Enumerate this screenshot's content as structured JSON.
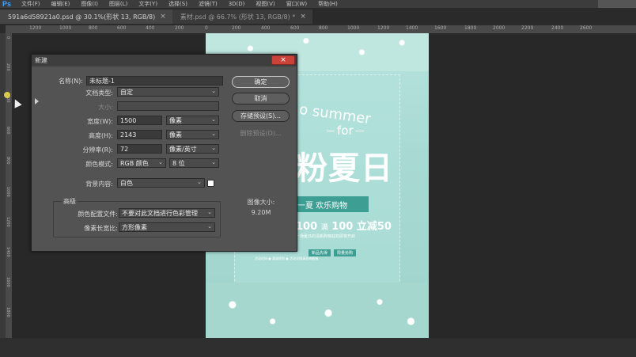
{
  "menubar": {
    "logo": "Ps",
    "items": [
      "文件(F)",
      "编辑(E)",
      "图像(I)",
      "图层(L)",
      "文字(Y)",
      "选择(S)",
      "滤镜(T)",
      "3D(D)",
      "视图(V)",
      "窗口(W)",
      "帮助(H)"
    ]
  },
  "tabs": [
    {
      "label": "591a6d58921a0.psd @ 30.1%(形状 13, RGB/8)",
      "close": "×"
    },
    {
      "label": "素材.psd @ 66.7% (形状 13, RGB/8) *",
      "close": "×"
    }
  ],
  "ruler": {
    "h_labels": [
      "1200",
      "1000",
      "800",
      "600",
      "400",
      "200",
      "0",
      "200",
      "400",
      "600",
      "800",
      "1000",
      "1200",
      "1400",
      "1600",
      "1800",
      "2000",
      "2200",
      "2400",
      "2600"
    ],
    "v_labels": [
      "0",
      "200",
      "400",
      "600",
      "800",
      "1000",
      "1200",
      "1400",
      "1600",
      "1800"
    ]
  },
  "poster": {
    "summer": "o summer",
    "for": "for",
    "title": "粉夏日",
    "ribbon": "一夏 欢乐购物",
    "promo_a": "100",
    "promo_mid": "满",
    "promo_b": "100",
    "promo_c": "立减50",
    "desc": "一场夏日的清新购物狂欢即将开启",
    "btn1": "新品先得",
    "btn2": "限量抢购",
    "fine": "活动时间 ● 满减规则 ● 活动详情请咨询客服"
  },
  "dialog": {
    "title": "新建",
    "close": "×",
    "name_label": "名称(N):",
    "name_value": "未标题-1",
    "doctype_label": "文档类型:",
    "doctype_value": "自定",
    "size_label": "大小:",
    "width_label": "宽度(W):",
    "width_value": "1500",
    "width_unit": "像素",
    "height_label": "高度(H):",
    "height_value": "2143",
    "height_unit": "像素",
    "res_label": "分辨率(R):",
    "res_value": "72",
    "res_unit": "像素/英寸",
    "mode_label": "颜色模式:",
    "mode_value": "RGB 颜色",
    "bit_value": "8 位",
    "bg_label": "背景内容:",
    "bg_value": "白色",
    "advanced_label": "高级",
    "profile_label": "颜色配置文件:",
    "profile_value": "不要对此文档进行色彩管理",
    "pixel_label": "像素长宽比:",
    "pixel_value": "方形像素",
    "ok": "确定",
    "cancel": "取消",
    "save_preset": "存储预设(S)...",
    "delete_preset": "删除预设(D)...",
    "image_size_label": "图像大小:",
    "image_size_value": "9.20M",
    "chevron": "⌄"
  }
}
